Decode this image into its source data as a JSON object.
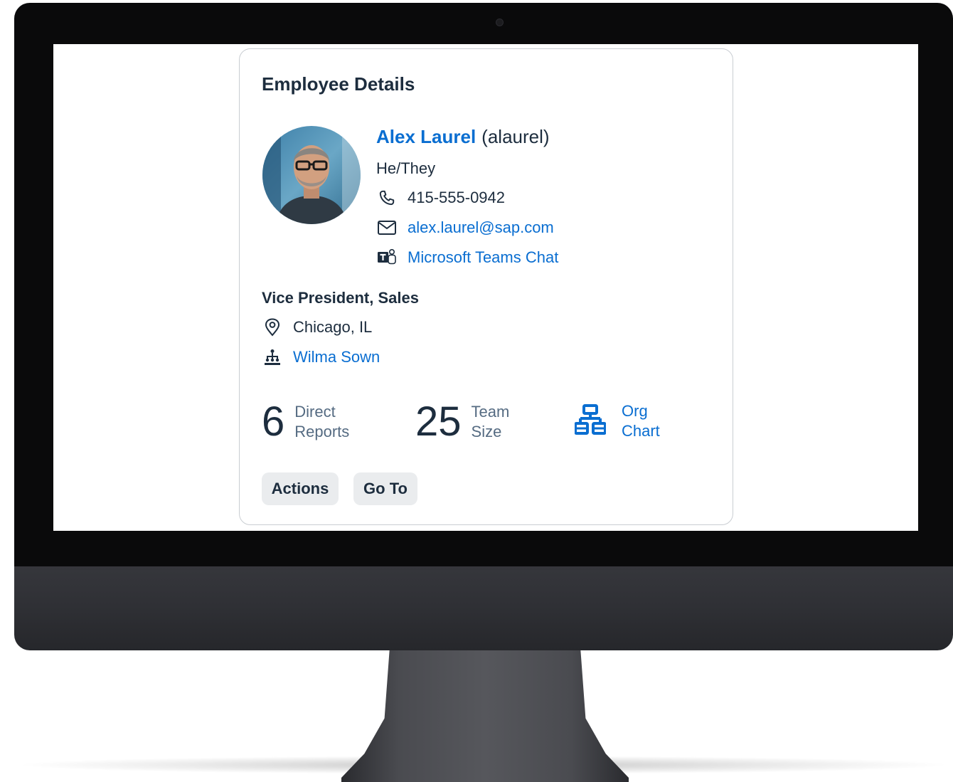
{
  "card": {
    "title": "Employee Details",
    "name": "Alex Laurel",
    "user_id": "(alaurel)",
    "pronouns": "He/They",
    "phone": "415-555-0942",
    "email": "alex.laurel@sap.com",
    "teams_chat": "Microsoft Teams Chat",
    "role": "Vice President, Sales",
    "location": "Chicago, IL",
    "manager": "Wilma Sown",
    "metrics": [
      {
        "value": "6",
        "label_line1": "Direct",
        "label_line2": "Reports"
      },
      {
        "value": "25",
        "label_line1": "Team",
        "label_line2": "Size"
      }
    ],
    "org_chart": {
      "label_line1": "Org",
      "label_line2": "Chart"
    },
    "buttons": {
      "actions": "Actions",
      "go_to": "Go To"
    }
  },
  "colors": {
    "link": "#0a6ed1",
    "text": "#1d2d3e",
    "muted": "#556b82",
    "button_bg": "#eaecee"
  },
  "icons": [
    "phone-icon",
    "mail-icon",
    "teams-icon",
    "location-icon",
    "hierarchy-icon",
    "org-chart-icon"
  ]
}
